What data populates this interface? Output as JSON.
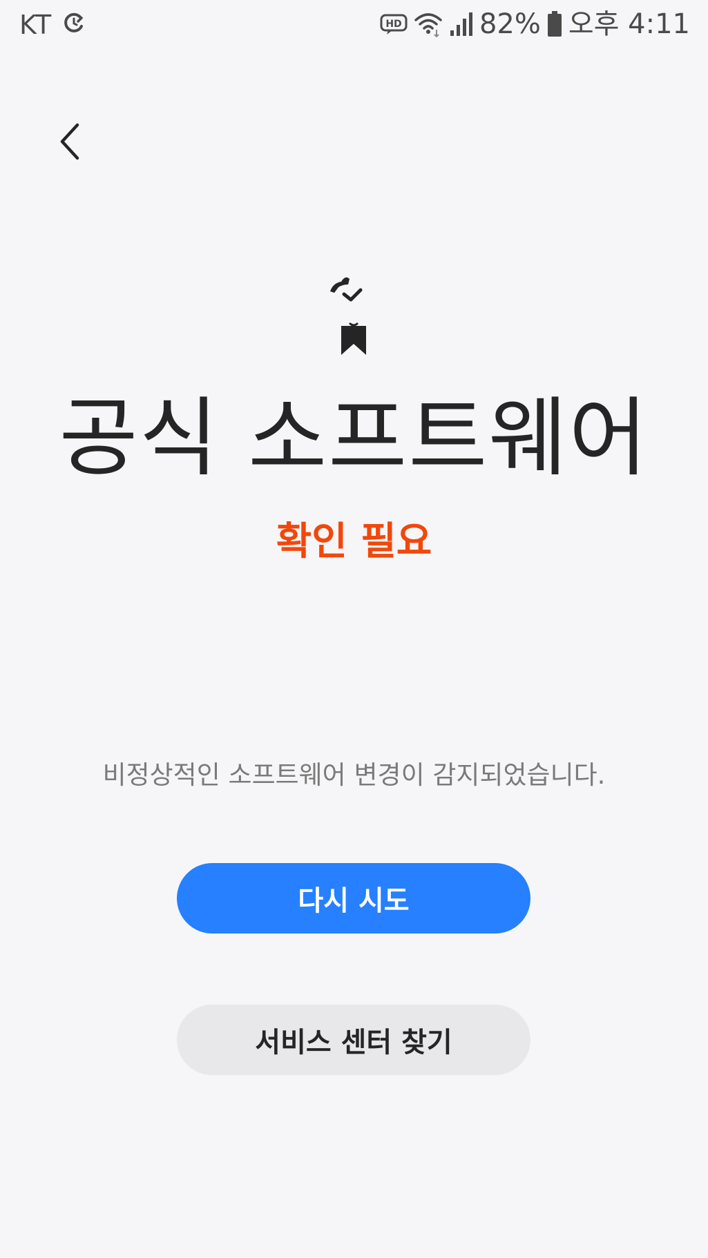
{
  "status_bar": {
    "carrier": "KT",
    "battery_percent": "82%",
    "time": "오후 4:11",
    "icons": [
      "sync-icon",
      "hd-icon",
      "wifi-icon",
      "signal-icon",
      "battery-icon"
    ]
  },
  "navigation": {
    "back_icon": "chevron-left-icon"
  },
  "main": {
    "icon": "shield-check-icon",
    "title": "공식 소프트웨어",
    "status": "확인 필요",
    "description": "비정상적인 소프트웨어 변경이 감지되었습니다."
  },
  "actions": {
    "retry_label": "다시 시도",
    "service_center_label": "서비스 센터 찾기"
  },
  "colors": {
    "background": "#f6f6f8",
    "accent_primary": "#2680ff",
    "warning": "#f2470c",
    "secondary_button": "#e8e8ea"
  }
}
